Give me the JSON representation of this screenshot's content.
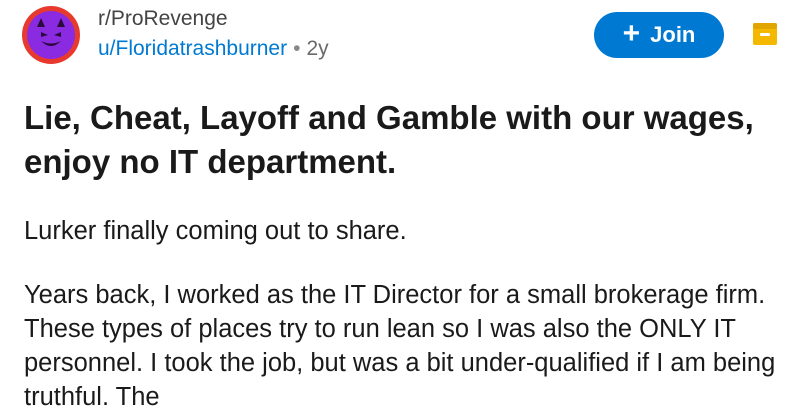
{
  "post": {
    "subreddit": "r/ProRevenge",
    "username": "u/Floridatrashburner",
    "separator": "•",
    "age": "2y",
    "join_label": "Join",
    "join_icon": "plus-icon",
    "avatar_icon": "devil-face-icon",
    "title": "Lie, Cheat, Layoff and Gamble with our wages, enjoy no IT department.",
    "paragraphs": [
      "Lurker finally coming out to share.",
      "Years back, I worked as the IT Director for a small brokerage firm. These types of places try to run lean so I was also the ONLY IT personnel. I took the job, but was a bit under-qualified if I am being truthful. The"
    ]
  },
  "colors": {
    "accent": "#0079d3",
    "avatar_ring": "#e8392f",
    "avatar_face": "#8a2be2",
    "award": "#f5b800"
  }
}
